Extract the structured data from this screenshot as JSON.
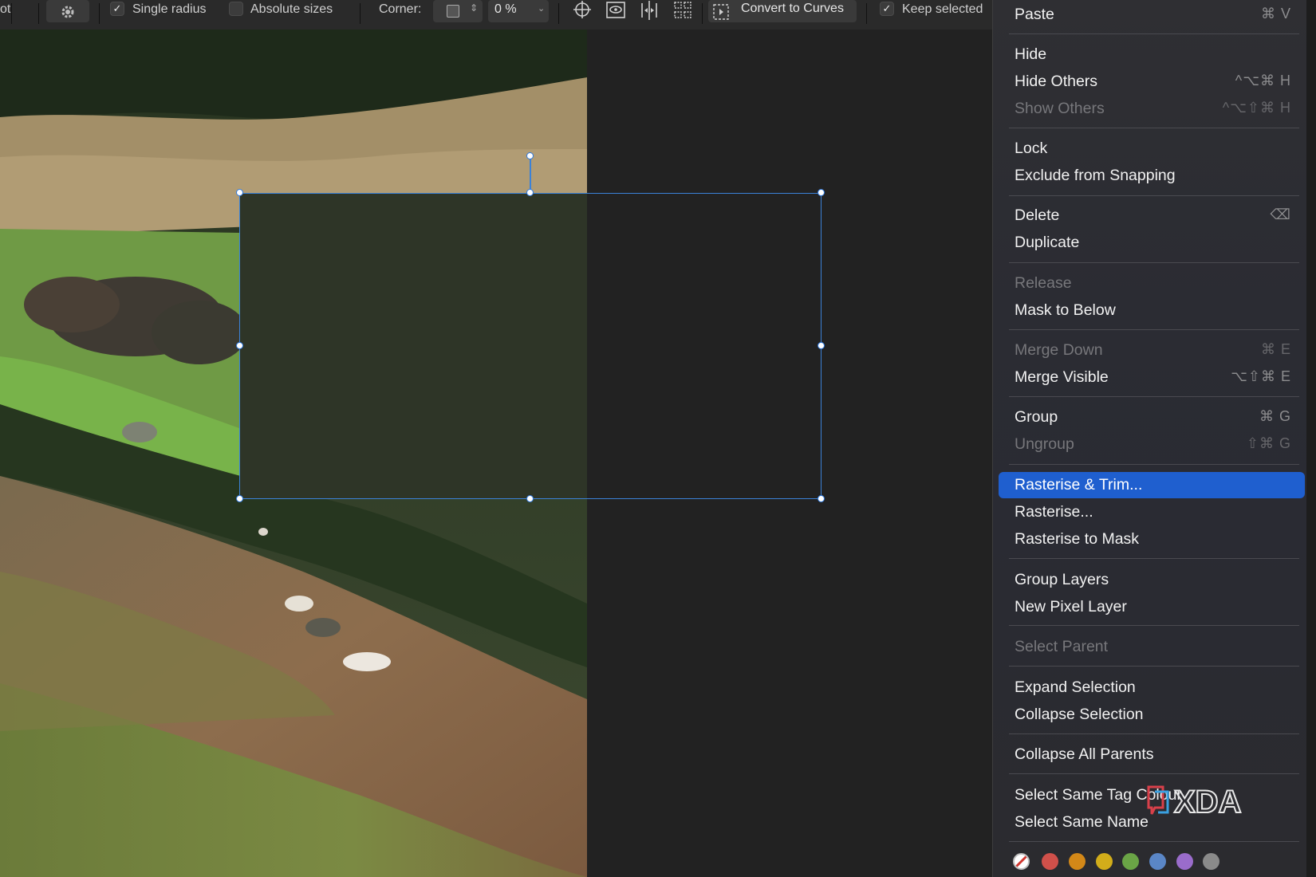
{
  "toolbar": {
    "partial_left": "ot",
    "single_radius_label": "Single radius",
    "absolute_sizes_label": "Absolute sizes",
    "corner_label": "Corner:",
    "corner_value": "0 %",
    "convert_label": "Convert to Curves",
    "keep_selected_label": "Keep selected",
    "single_radius_checked": true,
    "absolute_sizes_checked": false,
    "keep_selected_checked": true,
    "icons": [
      "gear-icon",
      "crosshair-icon",
      "eye-frame-icon",
      "align-center-icon",
      "distribute-icon",
      "convert-curves-icon"
    ]
  },
  "menu": {
    "items": [
      {
        "label": "Paste",
        "shortcut": "⌘ V",
        "disabled": false
      },
      {
        "label": "Hide",
        "shortcut": "",
        "disabled": false
      },
      {
        "label": "Hide Others",
        "shortcut": "^⌥⌘ H",
        "disabled": false
      },
      {
        "label": "Show Others",
        "shortcut": "^⌥⇧⌘ H",
        "disabled": true
      },
      {
        "label": "Lock",
        "shortcut": "",
        "disabled": false
      },
      {
        "label": "Exclude from Snapping",
        "shortcut": "",
        "disabled": false
      },
      {
        "label": "Delete",
        "shortcut": "⌫",
        "disabled": false
      },
      {
        "label": "Duplicate",
        "shortcut": "",
        "disabled": false
      },
      {
        "label": "Release",
        "shortcut": "",
        "disabled": true
      },
      {
        "label": "Mask to Below",
        "shortcut": "",
        "disabled": false
      },
      {
        "label": "Merge Down",
        "shortcut": "⌘ E",
        "disabled": true
      },
      {
        "label": "Merge Visible",
        "shortcut": "⌥⇧⌘ E",
        "disabled": false
      },
      {
        "label": "Group",
        "shortcut": "⌘ G",
        "disabled": false
      },
      {
        "label": "Ungroup",
        "shortcut": "⇧⌘ G",
        "disabled": true
      },
      {
        "label": "Rasterise & Trim...",
        "shortcut": "",
        "disabled": false,
        "highlighted": true
      },
      {
        "label": "Rasterise...",
        "shortcut": "",
        "disabled": false
      },
      {
        "label": "Rasterise to Mask",
        "shortcut": "",
        "disabled": false
      },
      {
        "label": "Group Layers",
        "shortcut": "",
        "disabled": false
      },
      {
        "label": "New Pixel Layer",
        "shortcut": "",
        "disabled": false
      },
      {
        "label": "Select Parent",
        "shortcut": "",
        "disabled": true
      },
      {
        "label": "Expand Selection",
        "shortcut": "",
        "disabled": false
      },
      {
        "label": "Collapse Selection",
        "shortcut": "",
        "disabled": false
      },
      {
        "label": "Collapse All Parents",
        "shortcut": "",
        "disabled": false
      },
      {
        "label": "Select Same Tag Colour",
        "shortcut": "",
        "disabled": false
      },
      {
        "label": "Select Same Name",
        "shortcut": "",
        "disabled": false
      }
    ],
    "tag_colors": [
      "#d0504a",
      "#d38818",
      "#d2ad1a",
      "#6aa446",
      "#5a86c6",
      "#9a6ccb",
      "#8a8a8a"
    ]
  },
  "watermark": {
    "text": "XDA"
  },
  "colors": {
    "accent": "#1f5fcf",
    "selection": "#3b82d8",
    "shape_fill": "#2e3527"
  }
}
